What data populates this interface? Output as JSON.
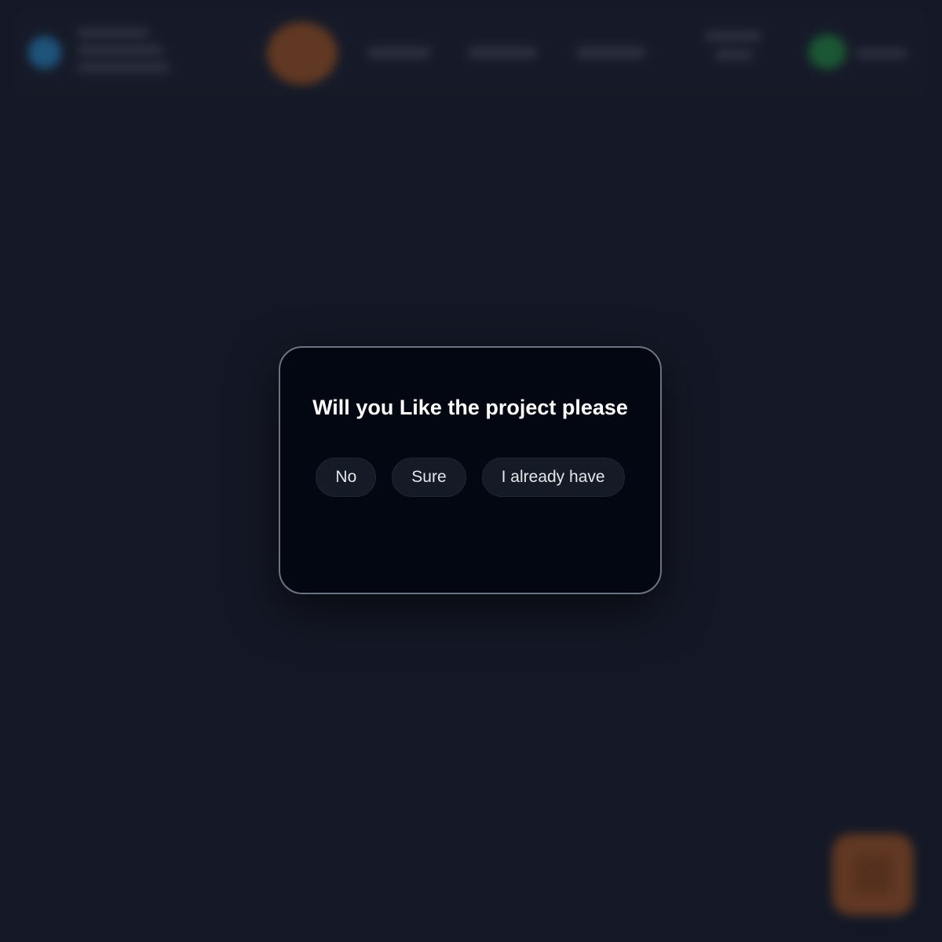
{
  "dialog": {
    "title": "Will you Like the project please",
    "buttons": {
      "no": "No",
      "sure": "Sure",
      "already": "I already have"
    }
  },
  "colors": {
    "page_background": "#151a27",
    "dialog_background": "#030712",
    "dialog_border": "#6b7280",
    "button_background": "#141a26",
    "button_text": "#e5e7eb",
    "accent_orange": "#8a4a22",
    "accent_blue": "#2473a8",
    "accent_green": "#1f7a3c"
  },
  "icons": {
    "logo": "logo-icon",
    "profile": "avatar",
    "status": "status-indicator-icon",
    "floating_action": "floating-action-icon"
  }
}
